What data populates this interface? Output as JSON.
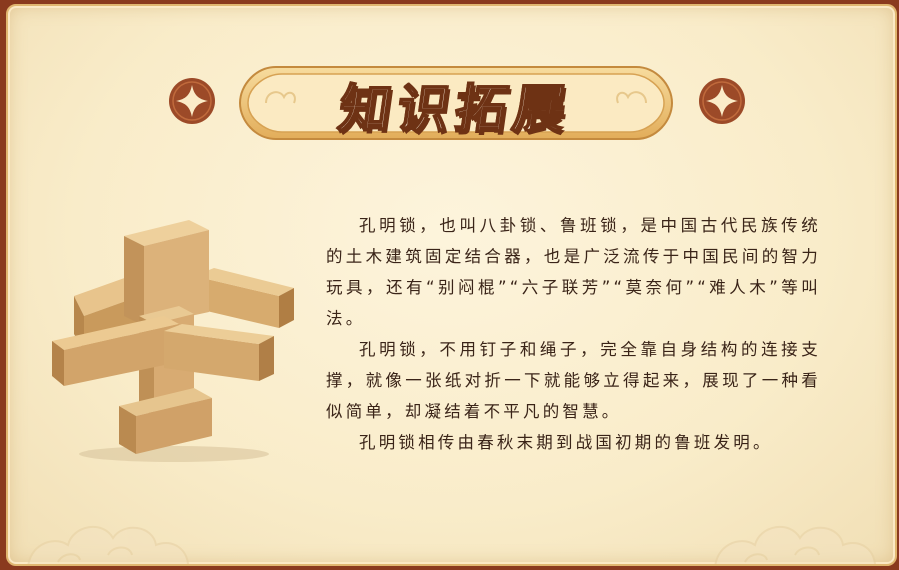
{
  "title": "知识拓展",
  "colors": {
    "frame": "#8a3a1e",
    "card_bg": "#fdf4dc",
    "banner_gold": "#e9bf70",
    "title_outline": "#6e3214",
    "text": "#3a2418"
  },
  "icons": {
    "left_ornament": "diamond-coin-icon",
    "right_ornament": "diamond-coin-icon",
    "illustration": "kongming-lock-wooden-puzzle"
  },
  "paragraphs": [
    "孔明锁，也叫八卦锁、鲁班锁，是中国古代民族传统的土木建筑固定结合器，也是广泛流传于中国民间的智力玩具，还有“别闷棍”“六子联芳”“莫奈何”“难人木”等叫法。",
    "孔明锁，不用钉子和绳子，完全靠自身结构的连接支撑，就像一张纸对折一下就能够立得起来，展现了一种看似简单，却凝结着不平凡的智慧。",
    "孔明锁相传由春秋末期到战国初期的鲁班发明。"
  ]
}
